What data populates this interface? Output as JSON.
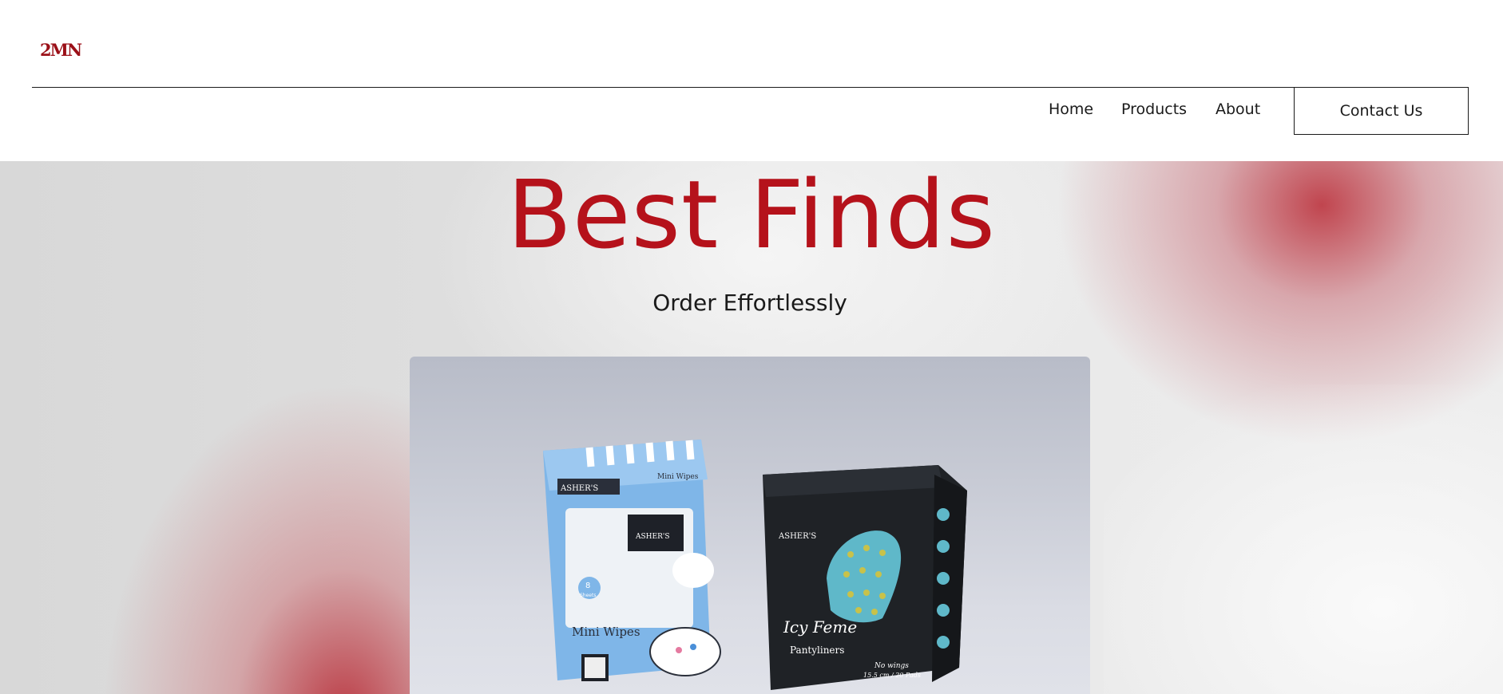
{
  "header": {
    "logo_text": "2MN",
    "logo_sub": "",
    "nav": {
      "home": "Home",
      "products": "Products",
      "about": "About"
    },
    "contact_label": "Contact Us"
  },
  "hero": {
    "title": "Best Finds",
    "subtitle": "Order Effortlessly"
  },
  "photo": {
    "blue_pack_brand": "ASHER'S",
    "blue_pack_top": "Mini Wipes",
    "blue_pack_count": "8",
    "blue_pack_count_unit": "Sheets",
    "blue_pack_name": "Mini Wipes",
    "dark_pack_brand": "ASHER'S",
    "dark_pack_name": "Icy Feme",
    "dark_pack_type": "Pantyliners",
    "dark_pack_note": "No wings",
    "dark_pack_size": "15.5 cm / 20 Pads"
  },
  "colors": {
    "brand_red": "#b5121b",
    "logo_red": "#9b1018",
    "text": "#1a1a1a"
  }
}
